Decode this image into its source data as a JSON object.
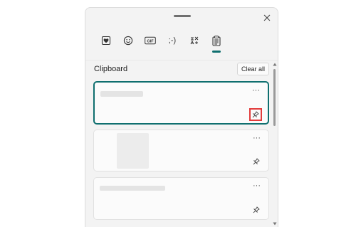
{
  "tabs": [
    {
      "icon": "heart-note-icon",
      "selected": false
    },
    {
      "icon": "emoji-icon",
      "selected": false
    },
    {
      "icon": "gif-icon",
      "label": "GIF",
      "selected": false
    },
    {
      "icon": "kaomoji-icon",
      "label": ";-)",
      "selected": false
    },
    {
      "icon": "symbols-icon",
      "selected": false
    },
    {
      "icon": "clipboard-icon",
      "selected": true
    }
  ],
  "clipboard": {
    "title": "Clipboard",
    "clear_all": "Clear all",
    "more_label": "···"
  },
  "colors": {
    "accent": "#0f6f6f",
    "highlight": "#e23b3b"
  }
}
